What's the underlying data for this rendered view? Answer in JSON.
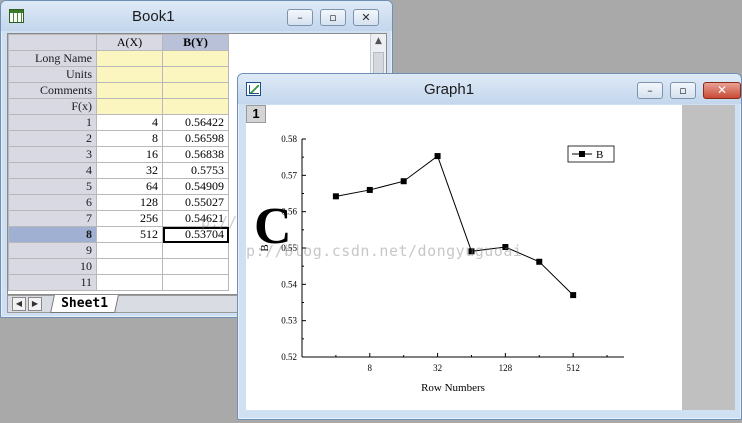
{
  "book": {
    "title": "Book1",
    "columns": [
      "A(X)",
      "B(Y)"
    ],
    "meta_rows": [
      "Long Name",
      "Units",
      "Comments",
      "F(x)"
    ],
    "rows": [
      {
        "label": "1",
        "a": "4",
        "b": "0.56422"
      },
      {
        "label": "2",
        "a": "8",
        "b": "0.56598"
      },
      {
        "label": "3",
        "a": "16",
        "b": "0.56838"
      },
      {
        "label": "4",
        "a": "32",
        "b": "0.5753"
      },
      {
        "label": "5",
        "a": "64",
        "b": "0.54909"
      },
      {
        "label": "6",
        "a": "128",
        "b": "0.55027"
      },
      {
        "label": "7",
        "a": "256",
        "b": "0.54621"
      },
      {
        "label": "8",
        "a": "512",
        "b": "0.53704"
      },
      {
        "label": "9",
        "a": "",
        "b": ""
      },
      {
        "label": "10",
        "a": "",
        "b": ""
      },
      {
        "label": "11",
        "a": "",
        "b": ""
      }
    ],
    "selected_row": "8",
    "sheet_tab": "Sheet1",
    "watermark": "p://blog."
  },
  "graph": {
    "title": "Graph1",
    "layer_label": "1",
    "panel_letter": "C",
    "watermark": "p://blog.csdn.net/dongyuguoai",
    "chart_data": {
      "type": "line",
      "x": [
        1,
        2,
        3,
        4,
        5,
        6,
        7,
        8
      ],
      "y": [
        0.56422,
        0.56598,
        0.56838,
        0.5753,
        0.54909,
        0.55027,
        0.54621,
        0.53704
      ],
      "series": [
        {
          "name": "B",
          "values": [
            0.56422,
            0.56598,
            0.56838,
            0.5753,
            0.54909,
            0.55027,
            0.54621,
            0.53704
          ]
        }
      ],
      "xlabel": "Row Numbers",
      "ylabel": "B",
      "xlim": [
        0,
        9.5
      ],
      "ylim": [
        0.52,
        0.58
      ],
      "yticks": [
        "0.52",
        "0.53",
        "0.54",
        "0.55",
        "0.56",
        "0.57",
        "0.58"
      ],
      "xticks": [
        {
          "pos": 2,
          "label": "8"
        },
        {
          "pos": 4,
          "label": "32"
        },
        {
          "pos": 6,
          "label": "128"
        },
        {
          "pos": 8,
          "label": "512"
        }
      ],
      "legend": "top-right",
      "grid": false
    }
  },
  "window_controls": {
    "minimize": "–",
    "maximize": "▫",
    "close": "✕"
  }
}
